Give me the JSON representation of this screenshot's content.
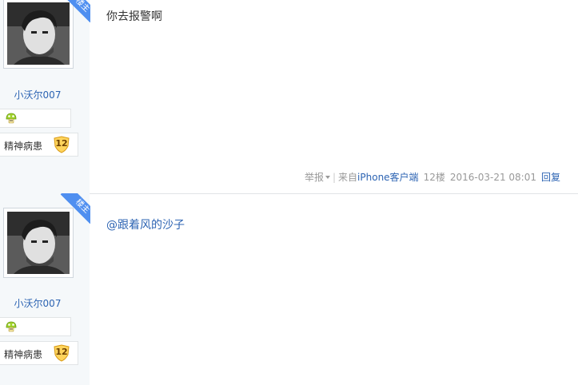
{
  "posts": [
    {
      "username": "小沃尔007",
      "rank_label": "精神病患",
      "rank_level": "12",
      "ribbon": "楼主",
      "content": "你去报警啊",
      "report": "举报",
      "source_prefix": "来自",
      "source": "iPhone客户端",
      "floor": "12楼",
      "time": "2016-03-21 08:01",
      "reply": "回复"
    },
    {
      "username": "小沃尔007",
      "rank_label": "精神病患",
      "rank_level": "12",
      "ribbon": "楼主",
      "content": "@跟着风的沙子"
    }
  ],
  "colors": {
    "accent": "#2d64b3",
    "ribbon": "#4f8ff0",
    "sidebar": "#f5f8fa"
  },
  "icons": {
    "level": "green-mushroom-icon",
    "rank": "gold-shield-badge-icon"
  }
}
